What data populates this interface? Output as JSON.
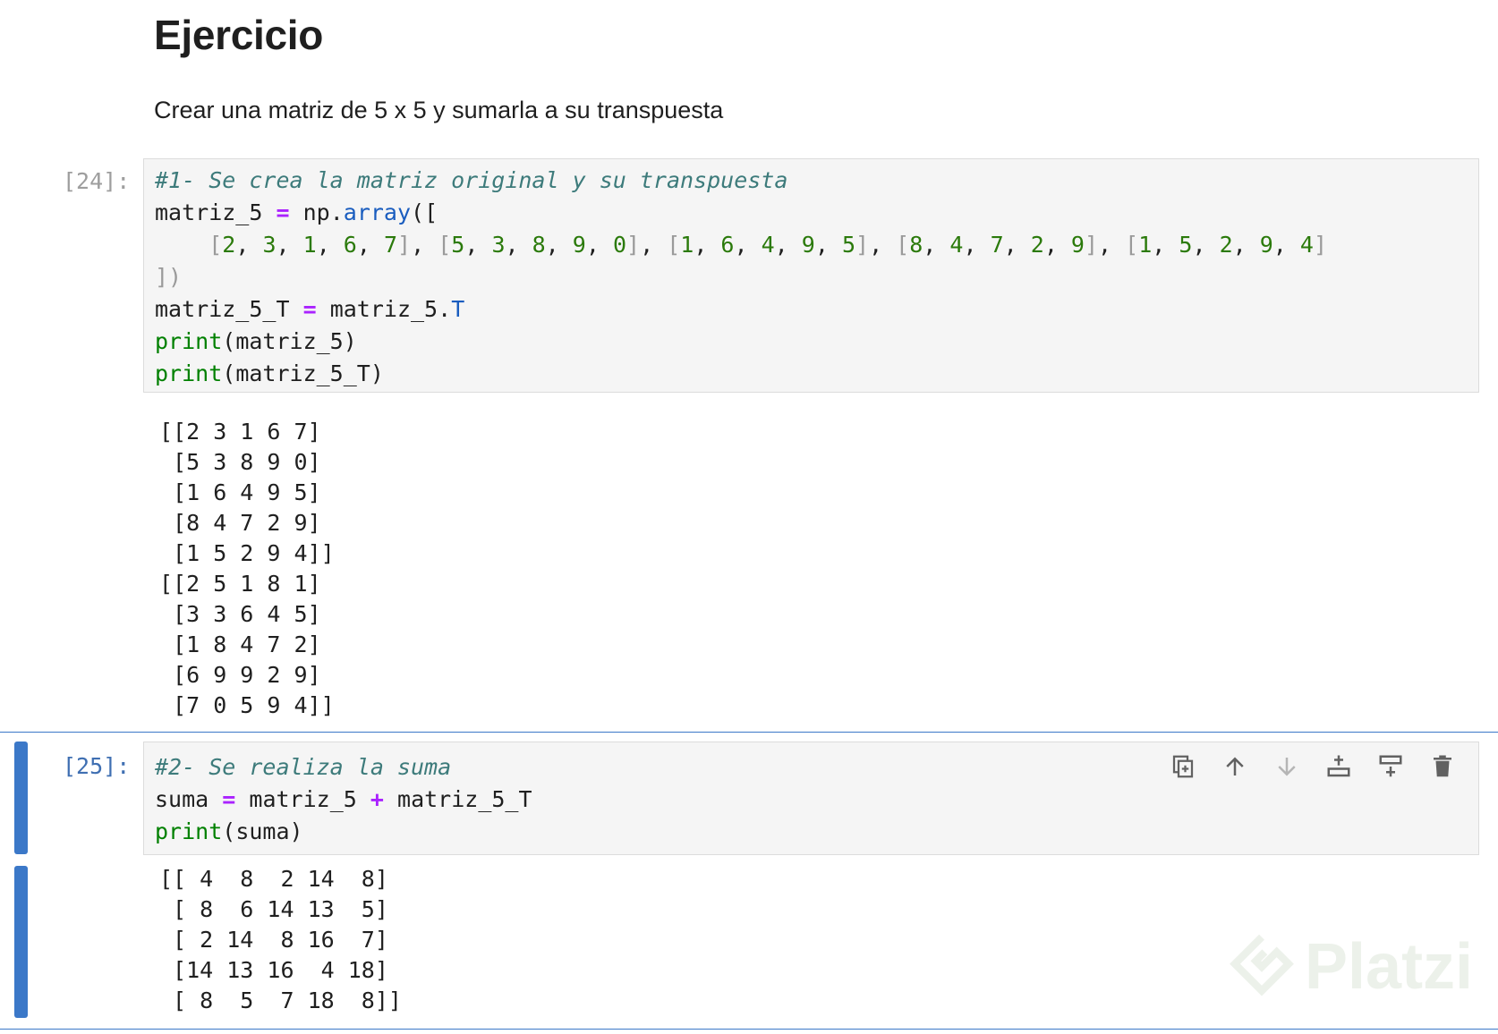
{
  "markdown": {
    "heading": "Ejercicio",
    "paragraph": "Crear una matriz de 5 x 5 y sumarla a su transpuesta"
  },
  "cells": [
    {
      "prompt": "[24]:",
      "code": {
        "comment": "#1- Se crea la matriz original y su transpuesta",
        "line2_name": "matriz_5",
        "line2_op": "=",
        "line2_mod": "np",
        "line2_dot": ".",
        "line2_func": "array",
        "line2_open": "([",
        "rows": [
          [
            "2",
            "3",
            "1",
            "6",
            "7"
          ],
          [
            "5",
            "3",
            "8",
            "9",
            "0"
          ],
          [
            "1",
            "6",
            "4",
            "9",
            "5"
          ],
          [
            "8",
            "4",
            "7",
            "2",
            "9"
          ],
          [
            "1",
            "5",
            "2",
            "9",
            "4"
          ]
        ],
        "line4_close": "])",
        "line5_name": "matriz_5_T",
        "line5_op": "=",
        "line5_obj": "matriz_5",
        "line5_attr": "T",
        "print_kw": "print",
        "print1_arg": "(matriz_5)",
        "print2_arg": "(matriz_5_T)"
      },
      "output": "[[2 3 1 6 7]\n [5 3 8 9 0]\n [1 6 4 9 5]\n [8 4 7 2 9]\n [1 5 2 9 4]]\n[[2 5 1 8 1]\n [3 3 6 4 5]\n [1 8 4 7 2]\n [6 9 9 2 9]\n [7 0 5 9 4]]"
    },
    {
      "prompt": "[25]:",
      "code": {
        "comment": "#2- Se realiza la suma",
        "line2_name": "suma",
        "line2_op1": "=",
        "line2_a": "matriz_5",
        "line2_op2": "+",
        "line2_b": "matriz_5_T",
        "print_kw": "print",
        "print_arg": "(suma)"
      },
      "output": "[[ 4  8  2 14  8]\n [ 8  6 14 13  5]\n [ 2 14  8 16  7]\n [14 13 16  4 18]\n [ 8  5  7 18  8]]"
    }
  ],
  "toolbar": {
    "icons": [
      "duplicate-icon",
      "move-up-icon",
      "move-down-icon",
      "insert-above-icon",
      "insert-below-icon",
      "delete-icon"
    ]
  },
  "watermark": {
    "text": "Platzi"
  },
  "colors": {
    "selection": "#3b78c8",
    "comment": "#3d7b7b",
    "operator": "#aa22ff",
    "number": "#2b7a0b",
    "builtin": "#008000",
    "attribute": "#1a5dbf"
  }
}
